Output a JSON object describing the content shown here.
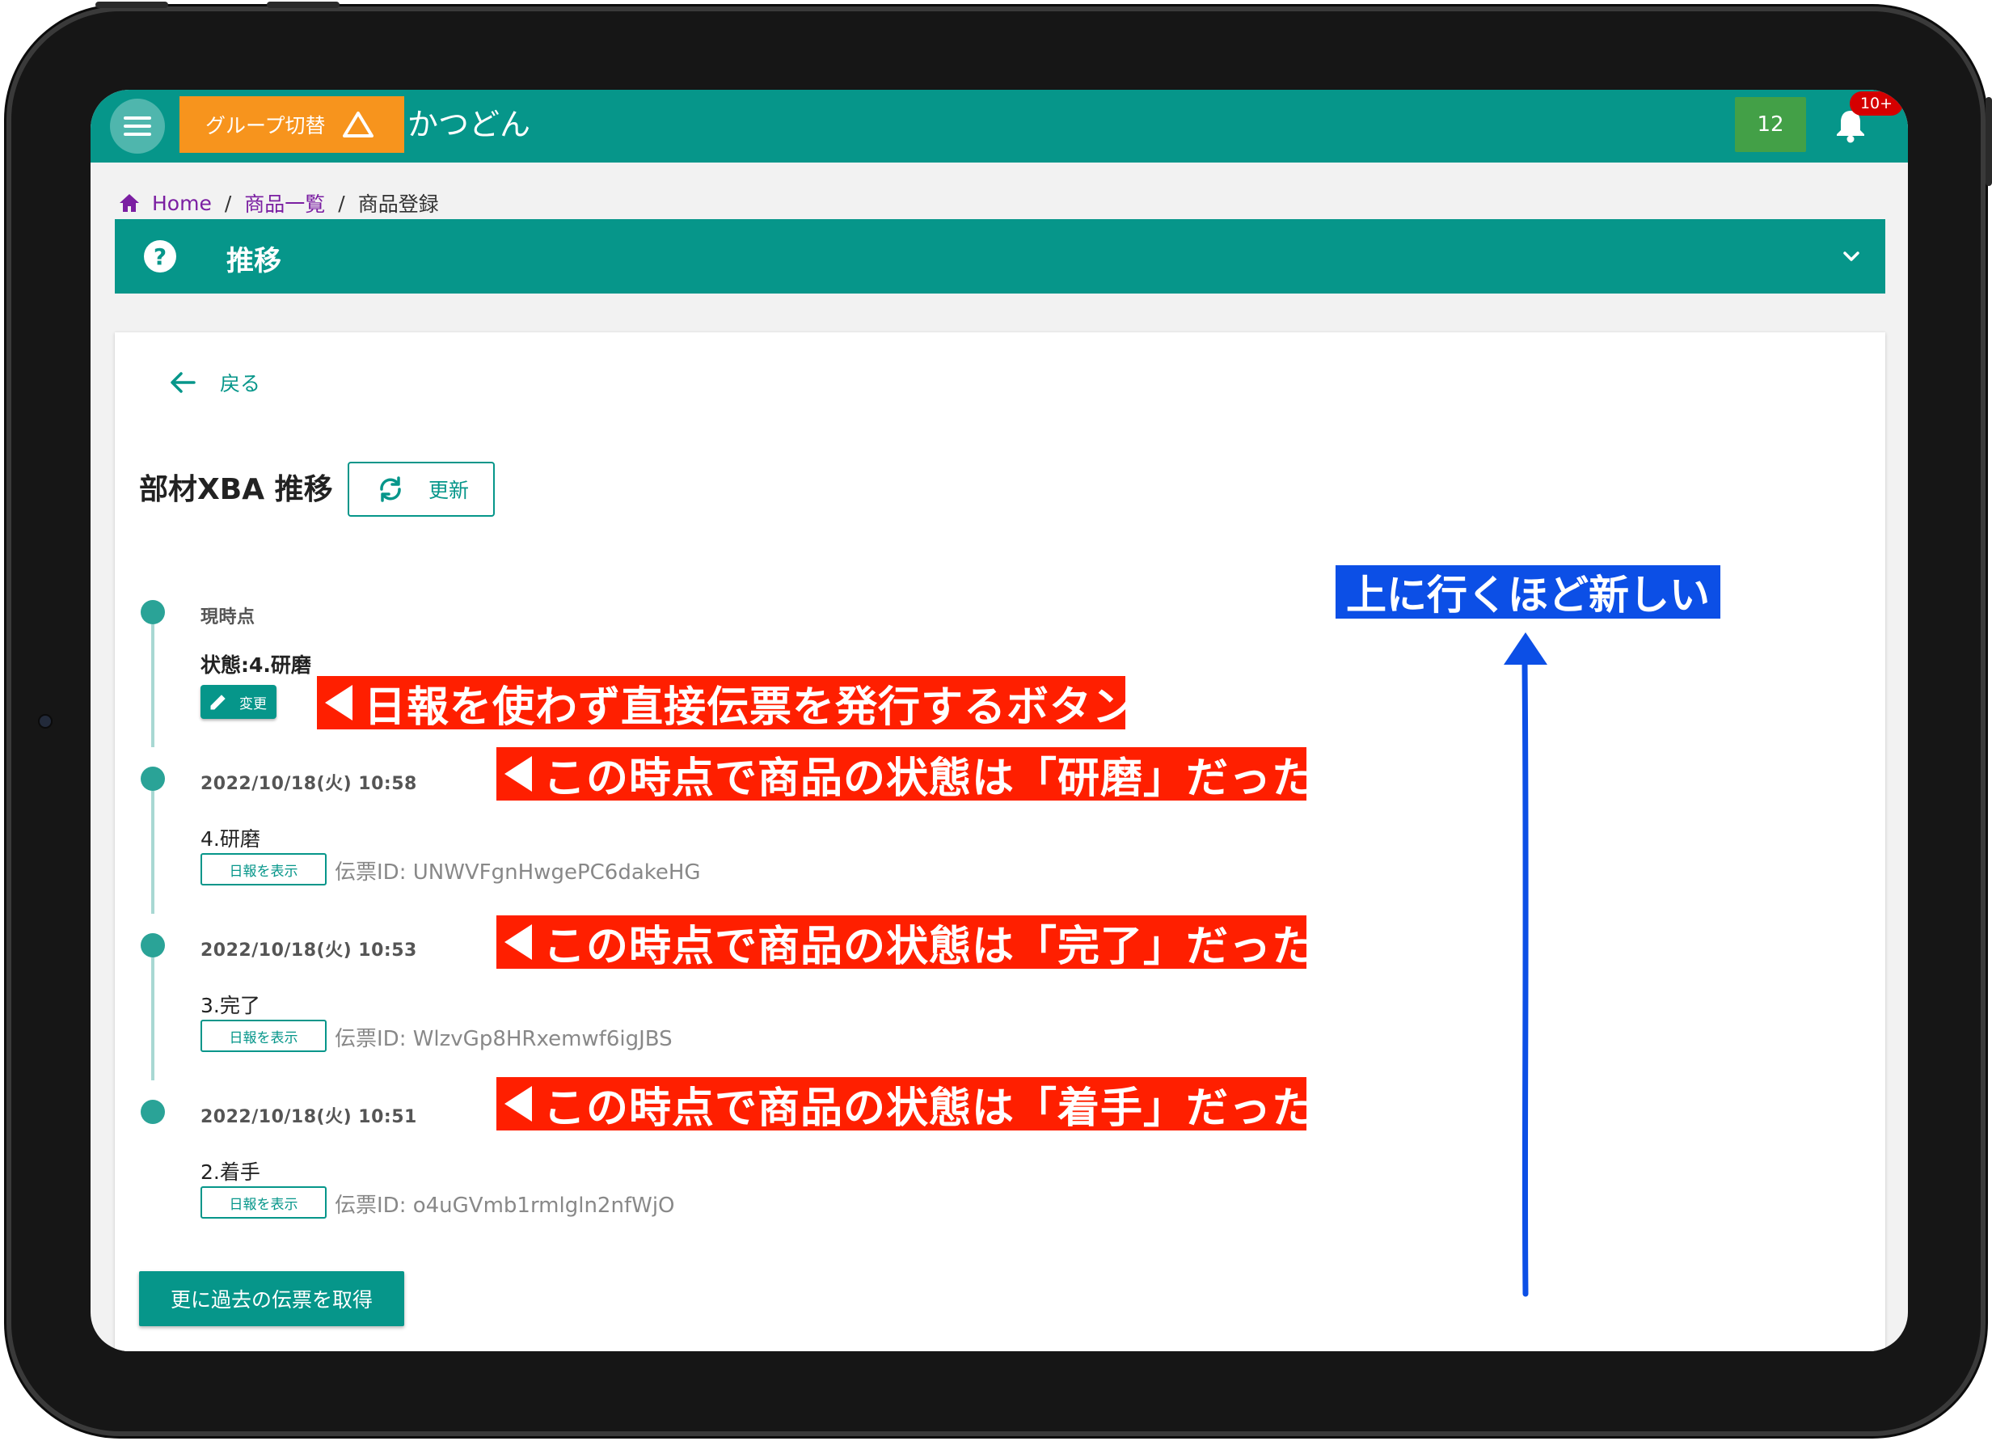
{
  "appbar": {
    "group_switch_label": "グループ切替",
    "app_title": "かつどん",
    "count_badge": "12",
    "notification_badge": "10+",
    "color": "#06968a",
    "group_button_color": "#f7941d"
  },
  "breadcrumb": {
    "home": "Home",
    "sep1": "/",
    "product_list": "商品一覧",
    "sep2": "/",
    "current": "商品登録"
  },
  "help_bar": {
    "title": "推移",
    "help_icon_text": "?"
  },
  "card": {
    "back_label": "戻る",
    "heading": "部材XBA 推移",
    "refresh_label": "更新"
  },
  "timeline": {
    "current": {
      "label": "現時点",
      "status": "状態:4.研磨",
      "edit_label": "変更"
    },
    "entries": [
      {
        "timestamp": "2022/10/18(火) 10:58",
        "status": "4.研磨",
        "report_label": "日報を表示",
        "slip_id": "伝票ID: UNWVFgnHwgePC6dakeHG"
      },
      {
        "timestamp": "2022/10/18(火) 10:53",
        "status": "3.完了",
        "report_label": "日報を表示",
        "slip_id": "伝票ID: WlzvGp8HRxemwf6igJBS"
      },
      {
        "timestamp": "2022/10/18(火) 10:51",
        "status": "2.着手",
        "report_label": "日報を表示",
        "slip_id": "伝票ID: o4uGVmb1rmlgln2nfWjO"
      }
    ],
    "more_label": "更に過去の伝票を取得"
  },
  "annotations": {
    "edit_note": "日報を使わず直接伝票を発行するボタン",
    "note_1": "この時点で商品の状態は「研磨」だった",
    "note_2": "この時点で商品の状態は「完了」だった",
    "note_3": "この時点で商品の状態は「着手」だった",
    "order_note": "上に行くほど新しい",
    "red_color": "#ff1f00",
    "blue_color": "#0c4fe6"
  }
}
